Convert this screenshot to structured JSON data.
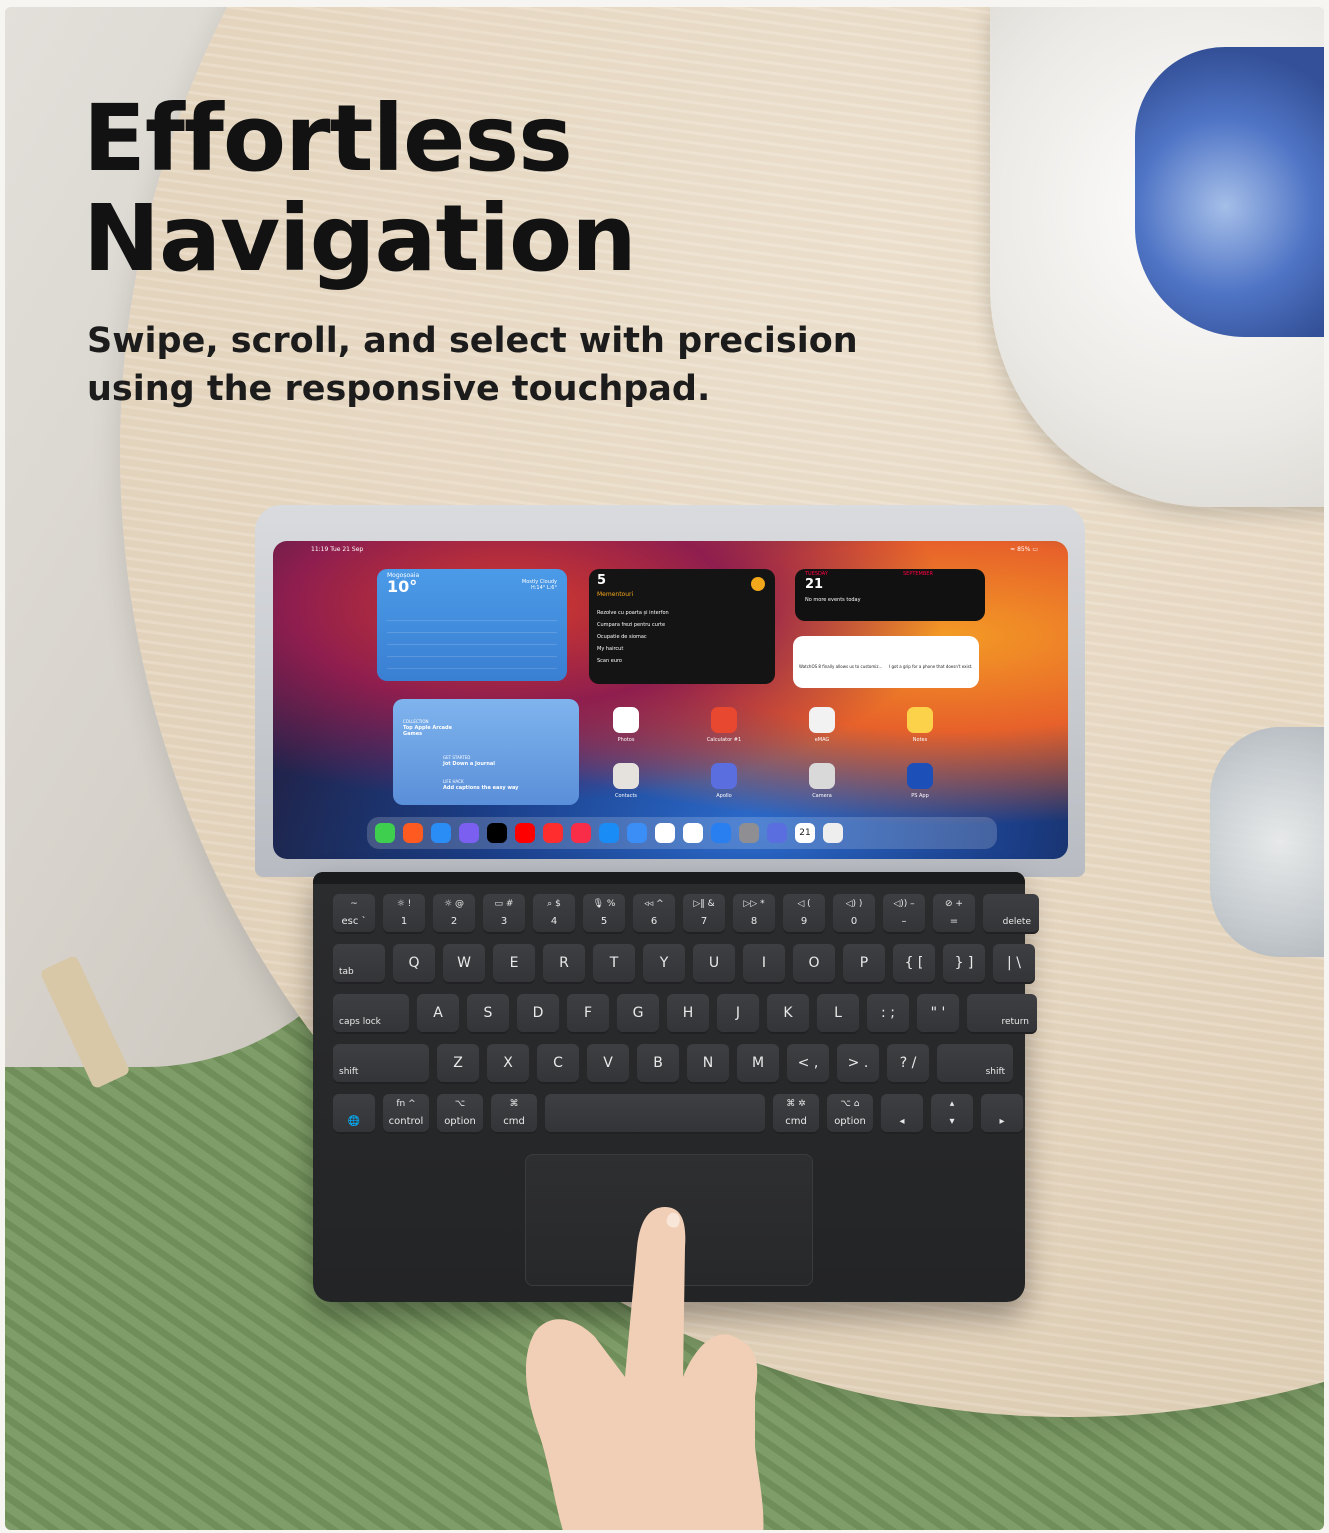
{
  "headline": {
    "line1": "Effortless",
    "line2": "Navigation"
  },
  "subheadline": {
    "line1": "Swipe, scroll, and select with precision",
    "line2": "using the responsive touchpad."
  },
  "colors": {
    "headline": "#121212",
    "subheadline": "#1c1c1c",
    "keyboard": "#2b2c2e",
    "rug_green": "#7f9d68",
    "table_wood": "#e6d7c1"
  },
  "keyboard": {
    "row1": [
      {
        "top": "~",
        "bot": "esc `"
      },
      {
        "top": "☼ !",
        "bot": "1"
      },
      {
        "top": "☼ @",
        "bot": "2"
      },
      {
        "top": "▭ #",
        "bot": "3"
      },
      {
        "top": "⌕ $",
        "bot": "4"
      },
      {
        "top": "🎙 %",
        "bot": "5"
      },
      {
        "top": "◃◃ ^",
        "bot": "6"
      },
      {
        "top": "▷‖ &",
        "bot": "7"
      },
      {
        "top": "▷▷ *",
        "bot": "8"
      },
      {
        "top": "◁ (",
        "bot": "9"
      },
      {
        "top": "◁) )",
        "bot": "0"
      },
      {
        "top": "◁)) –",
        "bot": "–"
      },
      {
        "top": "⊘ +",
        "bot": "="
      },
      {
        "top": "",
        "bot": "delete"
      }
    ],
    "row2": [
      "tab",
      "Q",
      "W",
      "E",
      "R",
      "T",
      "Y",
      "U",
      "I",
      "O",
      "P",
      "{ [",
      "} ]",
      "| \\"
    ],
    "row3": [
      "caps lock",
      "A",
      "S",
      "D",
      "F",
      "G",
      "H",
      "J",
      "K",
      "L",
      ": ;",
      "\" '",
      "return"
    ],
    "row4": [
      "shift",
      "Z",
      "X",
      "C",
      "V",
      "B",
      "N",
      "M",
      "< ,",
      "> .",
      "? /",
      "shift"
    ],
    "row5": [
      {
        "top": "",
        "bot": "🌐"
      },
      {
        "top": "fn ^",
        "bot": "control"
      },
      {
        "top": "⌥",
        "bot": "option"
      },
      {
        "top": "⌘",
        "bot": "cmd"
      },
      {
        "top": "",
        "bot": ""
      },
      {
        "top": "⌘ ✲",
        "bot": "cmd"
      },
      {
        "top": "⌥ ⌂",
        "bot": "option"
      },
      {
        "top": "",
        "bot": "◂"
      },
      {
        "top": "▴",
        "bot": "▾"
      },
      {
        "top": "",
        "bot": "▸"
      }
    ]
  },
  "tablet": {
    "status_time": "11:19  Tue 21 Sep",
    "status_battery": "≈ 85% ▭",
    "weather": {
      "location": "Mogoșoaia",
      "temp": "10°",
      "condition": "Mostly Cloudy",
      "range": "H:14° L:6°"
    },
    "reminders": {
      "count": "5",
      "title": "Mementouri",
      "items": [
        "Rezolve cu poarta și interfon",
        "Cumpara frezi pentru curte",
        "Ocupatie de siomac",
        "My haircut",
        "Scan euro"
      ]
    },
    "calendar": {
      "weekday": "TUESDAY",
      "day": "21",
      "note": "No more events today",
      "month": "SEPTEMBER"
    },
    "news": {
      "headline1": "WatchOS 8 finally allows us to customiz...",
      "headline2": "I got a grip for a phone that doesn't exist."
    },
    "arcade": {
      "label1": "COLLECTION",
      "title1": "Top Apple Arcade Games",
      "label2": "GET STARTED",
      "title2": "Jot Down a Journal",
      "label3": "LIFE HACK",
      "title3": "Add captions the easy way"
    },
    "apps": [
      "Photos",
      "Calculator #1",
      "eMAG",
      "Notes",
      "Contacts",
      "Apollo",
      "Camera",
      "PS App"
    ],
    "dock_calendar_day": "21"
  }
}
